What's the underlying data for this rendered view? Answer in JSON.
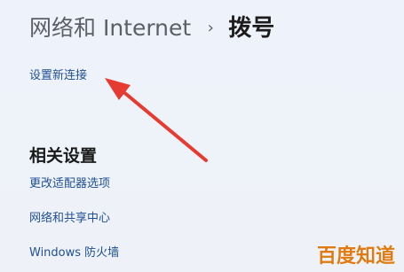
{
  "header": {
    "parent_crumb": "网络和 Internet",
    "separator_icon": "chevron-right-icon",
    "separator_glyph": "›",
    "current_page": "拨号"
  },
  "main": {
    "setup_link": "设置新连接"
  },
  "related": {
    "title": "相关设置",
    "links": [
      "更改适配器选项",
      "网络和共享中心",
      "Windows 防火墙"
    ]
  },
  "watermark": {
    "text": "百度知道"
  },
  "colors": {
    "background": "#eef2f9",
    "link": "#1f4f94",
    "arrow": "#e53b30",
    "watermark": "#e07a12"
  }
}
